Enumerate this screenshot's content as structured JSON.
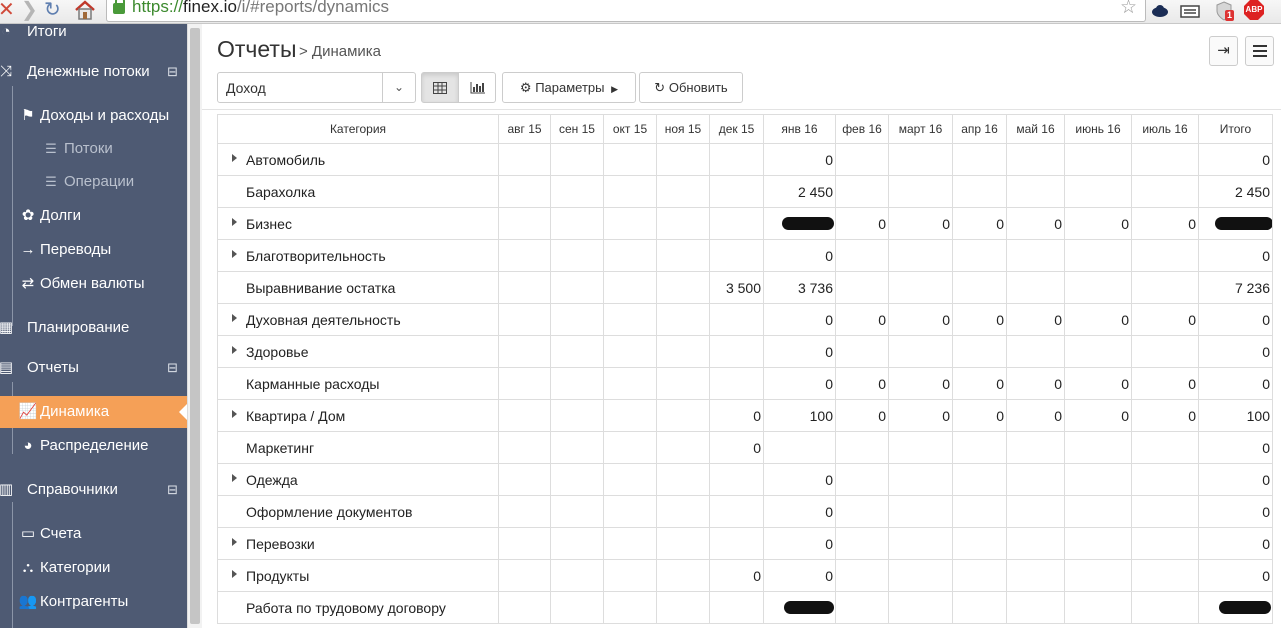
{
  "browser": {
    "url_scheme": "https://",
    "url_host": "finex.io",
    "url_path": "/i/#reports/dynamics",
    "ext_badge": "1",
    "abp_label": "ABP"
  },
  "sidebar": {
    "items": [
      {
        "label": "Итоги",
        "icon": "dashboard-icon"
      },
      {
        "label": "Денежные потоки",
        "icon": "shuffle-icon",
        "toggle": "⊟"
      },
      {
        "label": "Доходы и расходы",
        "icon": "flag-icon"
      },
      {
        "label": "Потоки",
        "icon": "list-icon"
      },
      {
        "label": "Операции",
        "icon": "list-icon"
      },
      {
        "label": "Долги",
        "icon": "gift-icon"
      },
      {
        "label": "Переводы",
        "icon": "arrow-right-icon"
      },
      {
        "label": "Обмен валюты",
        "icon": "exchange-icon"
      },
      {
        "label": "Планирование",
        "icon": "calendar-icon"
      },
      {
        "label": "Отчеты",
        "icon": "file-icon",
        "toggle": "⊟"
      },
      {
        "label": "Динамика",
        "icon": "line-chart-icon"
      },
      {
        "label": "Распределение",
        "icon": "pie-chart-icon"
      },
      {
        "label": "Справочники",
        "icon": "book-icon",
        "toggle": "⊟"
      },
      {
        "label": "Счета",
        "icon": "credit-card-icon"
      },
      {
        "label": "Категории",
        "icon": "sitemap-icon"
      },
      {
        "label": "Контрагенты",
        "icon": "users-icon"
      }
    ]
  },
  "header": {
    "title": "Отчеты",
    "breadcrumb": "> Динамика"
  },
  "toolbar": {
    "select_value": "Доход",
    "params_label": "Параметры",
    "refresh_label": "Обновить"
  },
  "grid": {
    "columns": [
      "Категория",
      "авг 15",
      "сен 15",
      "окт 15",
      "ноя 15",
      "дек 15",
      "янв 16",
      "фев 16",
      "март 16",
      "апр 16",
      "май 16",
      "июнь 16",
      "июль 16",
      "Итого"
    ],
    "rows": [
      {
        "category": "Автомобиль",
        "expandable": true,
        "values": [
          "",
          "",
          "",
          "",
          "",
          "0",
          "",
          "",
          "",
          "",
          "",
          "",
          "0"
        ]
      },
      {
        "category": "Барахолка",
        "expandable": false,
        "values": [
          "",
          "",
          "",
          "",
          "",
          "2 450",
          "",
          "",
          "",
          "",
          "",
          "",
          "2 450"
        ]
      },
      {
        "category": "Бизнес",
        "expandable": true,
        "values": [
          "",
          "",
          "",
          "",
          "",
          "0",
          "0",
          "0",
          "0",
          "0",
          "0",
          "0",
          ""
        ]
      },
      {
        "category": "Благотворительность",
        "expandable": true,
        "values": [
          "",
          "",
          "",
          "",
          "",
          "0",
          "",
          "",
          "",
          "",
          "",
          "",
          "0"
        ]
      },
      {
        "category": "Выравнивание остатка",
        "expandable": false,
        "values": [
          "",
          "",
          "",
          "",
          "3 500",
          "3 736",
          "",
          "",
          "",
          "",
          "",
          "",
          "7 236"
        ]
      },
      {
        "category": "Духовная деятельность",
        "expandable": true,
        "values": [
          "",
          "",
          "",
          "",
          "",
          "0",
          "0",
          "0",
          "0",
          "0",
          "0",
          "0",
          "0"
        ]
      },
      {
        "category": "Здоровье",
        "expandable": true,
        "values": [
          "",
          "",
          "",
          "",
          "",
          "0",
          "",
          "",
          "",
          "",
          "",
          "",
          "0"
        ]
      },
      {
        "category": "Карманные расходы",
        "expandable": false,
        "values": [
          "",
          "",
          "",
          "",
          "",
          "0",
          "0",
          "0",
          "0",
          "0",
          "0",
          "0",
          "0"
        ]
      },
      {
        "category": "Квартира / Дом",
        "expandable": true,
        "values": [
          "",
          "",
          "",
          "",
          "0",
          "100",
          "0",
          "0",
          "0",
          "0",
          "0",
          "0",
          "100"
        ]
      },
      {
        "category": "Маркетинг",
        "expandable": false,
        "values": [
          "",
          "",
          "",
          "",
          "0",
          "",
          "",
          "",
          "",
          "",
          "",
          "",
          "0"
        ]
      },
      {
        "category": "Одежда",
        "expandable": true,
        "values": [
          "",
          "",
          "",
          "",
          "",
          "0",
          "",
          "",
          "",
          "",
          "",
          "",
          "0"
        ]
      },
      {
        "category": "Оформление документов",
        "expandable": false,
        "values": [
          "",
          "",
          "",
          "",
          "",
          "0",
          "",
          "",
          "",
          "",
          "",
          "",
          "0"
        ]
      },
      {
        "category": "Перевозки",
        "expandable": true,
        "values": [
          "",
          "",
          "",
          "",
          "",
          "0",
          "",
          "",
          "",
          "",
          "",
          "",
          "0"
        ]
      },
      {
        "category": "Продукты",
        "expandable": true,
        "values": [
          "",
          "",
          "",
          "",
          "0",
          "0",
          "",
          "",
          "",
          "",
          "",
          "",
          "0"
        ]
      },
      {
        "category": "Работа по трудовому договору",
        "expandable": false,
        "values": [
          "",
          "",
          "",
          "",
          "",
          "",
          "",
          "",
          "",
          "",
          "",
          "",
          ""
        ]
      }
    ]
  }
}
